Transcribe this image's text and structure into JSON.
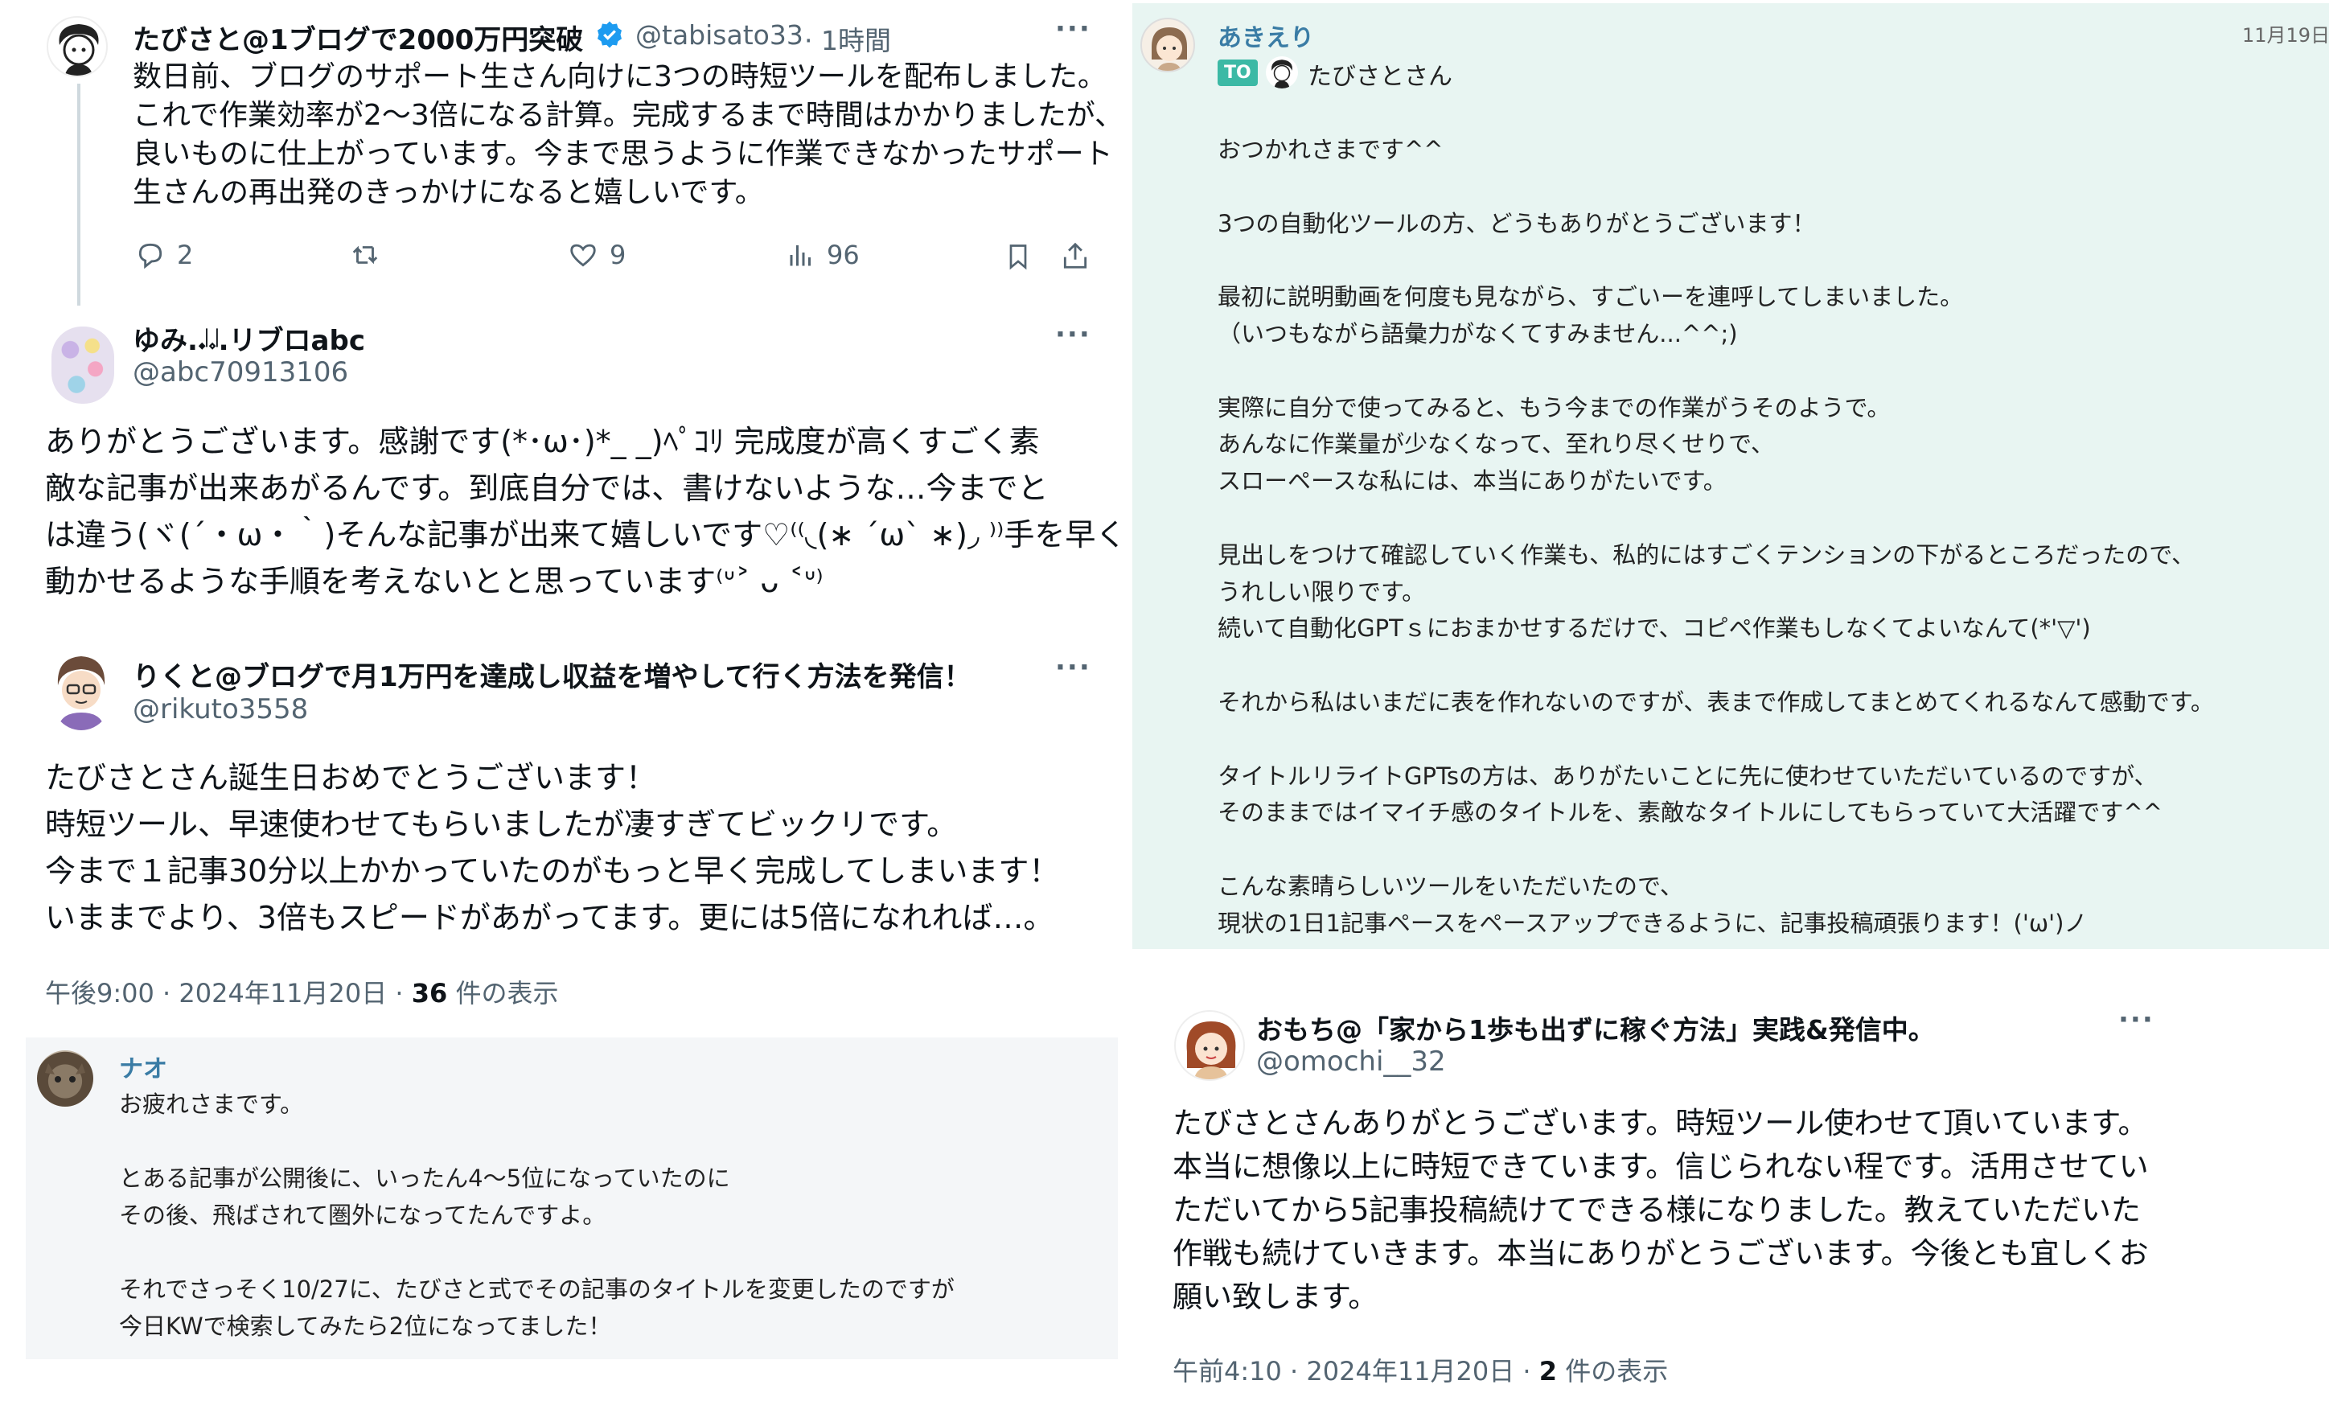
{
  "tweet1": {
    "name": "たびさと@1ブログで2000万円突破",
    "handle": "@tabisato33",
    "time": "· 1時間",
    "more": "···",
    "text": "数日前、ブログのサポート生さん向けに3つの時短ツールを配布しました。\nこれで作業効率が2〜3倍になる計算。完成するまで時間はかかりましたが、\n良いものに仕上がっています。今まで思うように作業できなかったサポート\n生さんの再出発のきっかけになると嬉しいです。",
    "replies": "2",
    "likes": "9",
    "views": "96"
  },
  "tweet2": {
    "name": "ゆみ.𝆺𝅥𝆹𝅥.リブロabc",
    "handle": "@abc70913106",
    "more": "···",
    "text": "ありがとうございます。感謝です(*･ω･)*_ _)ﾍﾟｺﾘ 完成度が高くすごく素\n敵な記事が出来あがるんです。到底自分では、書けないような…今までと\nは違う(ヾ(´・ω・｀)そんな記事が出来て嬉しいです♡⁽⁽◟(∗ ˊωˋ ∗)◞ ⁾⁾手を早く\n動かせるような手順を考えないとと思っています⁽ᐡ˃ ᴗ ˂ᐡ⁾"
  },
  "tweet3": {
    "name": "りくと@ブログで月1万円を達成し収益を増やして行く方法を発信！",
    "handle": "@rikuto3558",
    "more": "···",
    "text": "たびさとさん誕生日おめでとうございます！\n時短ツール、早速使わせてもらいましたが凄すぎてビックリです。\n今まで１記事30分以上かかっていたのがもっと早く完成してしまいます！\nいままでより、3倍もスピードがあがってます。更には5倍になれれば…。",
    "time": "午後9:00 · 2024年11月20日 · ",
    "views": "36",
    "views_suffix": " 件の表示"
  },
  "chat_nao": {
    "name": "ナオ",
    "text": "お疲れさまです。\n\nとある記事が公開後に、いったん4〜5位になっていたのに\nその後、飛ばされて圏外になってたんですよ。\n\nそれでさっそく10/27に、たびさと式でその記事のタイトルを変更したのですが\n今日KWで検索してみたら2位になってました！"
  },
  "chat_akieri": {
    "name": "あきえり",
    "date": "11月19日",
    "to_label": "TO",
    "to_name": "たびさとさん",
    "text": "おつかれさまです^^\n\n3つの自動化ツールの方、どうもありがとうございます！\n\n最初に説明動画を何度も見ながら、すごいーを連呼してしまいました。\n（いつもながら語彙力がなくてすみません...^^;)\n\n実際に自分で使ってみると、もう今までの作業がうそのようで。\nあんなに作業量が少なくなって、至れり尽くせりで、\nスローペースな私には、本当にありがたいです。\n\n見出しをつけて確認していく作業も、私的にはすごくテンションの下がるところだったので、\nうれしい限りです。\n続いて自動化GPTｓにおまかせするだけで、コピペ作業もしなくてよいなんて(*'▽')\n\nそれから私はいまだに表を作れないのですが、表まで作成してまとめてくれるなんて感動です。\n\nタイトルリライトGPTsの方は、ありがたいことに先に使わせていただいているのですが、\nそのままではイマイチ感のタイトルを、素敵なタイトルにしてもらっていて大活躍です^^\n\nこんな素晴らしいツールをいただいたので、\n現状の1日1記事ペースをペースアップできるように、記事投稿頑張ります！('ω')ノ"
  },
  "tweet4": {
    "name": "おもち@「家から1歩も出ずに稼ぐ方法」実践&発信中。",
    "handle": "@omochi__32",
    "more": "···",
    "text": "たびさとさんありがとうございます。時短ツール使わせて頂いています。\n本当に想像以上に時短できています。信じられない程です。活用させてい\nただいてから5記事投稿続けてできる様になりました。教えていただいた\n作戦も続けていきます。本当にありがとうございます。今後とも宜しくお\n願い致します。",
    "time": "午前4:10 · 2024年11月20日 · ",
    "views": "2",
    "views_suffix": " 件の表示"
  },
  "colors": {
    "verified": "#1d9bf0",
    "chat_bg_green": "#e8f5f2",
    "chat_bg_gray": "#f4f6f8",
    "to_badge": "#3cb9a5"
  }
}
